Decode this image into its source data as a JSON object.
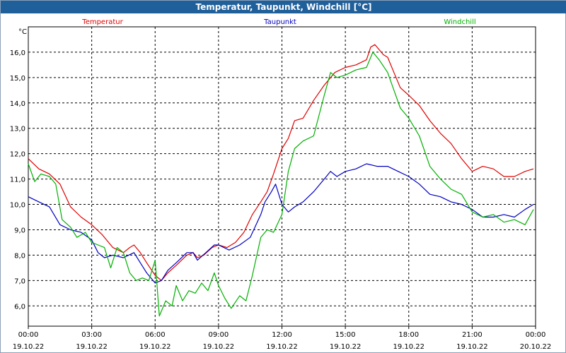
{
  "title": "Temperatur, Taupunkt, Windchill [°C]",
  "chart_data": {
    "type": "line",
    "ylabel": "°C",
    "ylim": [
      5.2,
      17.0
    ],
    "xlim_hours": [
      0,
      24
    ],
    "grid": true,
    "yticks": [
      "6,0",
      "7,0",
      "8,0",
      "9,0",
      "10,0",
      "11,0",
      "12,0",
      "13,0",
      "14,0",
      "15,0",
      "16,0"
    ],
    "yticks_values": [
      6,
      7,
      8,
      9,
      10,
      11,
      12,
      13,
      14,
      15,
      16
    ],
    "xticks": [
      {
        "time": "00:00",
        "date": "19.10.22",
        "h": 0
      },
      {
        "time": "03:00",
        "date": "19.10.22",
        "h": 3
      },
      {
        "time": "06:00",
        "date": "19.10.22",
        "h": 6
      },
      {
        "time": "09:00",
        "date": "19.10.22",
        "h": 9
      },
      {
        "time": "12:00",
        "date": "19.10.22",
        "h": 12
      },
      {
        "time": "15:00",
        "date": "19.10.22",
        "h": 15
      },
      {
        "time": "18:00",
        "date": "19.10.22",
        "h": 18
      },
      {
        "time": "21:00",
        "date": "19.10.22",
        "h": 21
      },
      {
        "time": "00:00",
        "date": "20.10.22",
        "h": 24
      }
    ],
    "series": [
      {
        "name": "Temperatur",
        "color": "#e00000",
        "points": [
          [
            0,
            11.8
          ],
          [
            0.5,
            11.4
          ],
          [
            1,
            11.2
          ],
          [
            1.5,
            10.8
          ],
          [
            2,
            9.9
          ],
          [
            2.5,
            9.5
          ],
          [
            3,
            9.2
          ],
          [
            3.5,
            8.8
          ],
          [
            4,
            8.3
          ],
          [
            4.5,
            8.1
          ],
          [
            4.8,
            8.3
          ],
          [
            5,
            8.4
          ],
          [
            5.3,
            8.1
          ],
          [
            5.6,
            7.7
          ],
          [
            6,
            7.2
          ],
          [
            6.3,
            7.0
          ],
          [
            6.6,
            7.3
          ],
          [
            7,
            7.6
          ],
          [
            7.5,
            8.0
          ],
          [
            7.8,
            8.1
          ],
          [
            8,
            7.9
          ],
          [
            8.3,
            8.0
          ],
          [
            8.7,
            8.3
          ],
          [
            9,
            8.4
          ],
          [
            9.4,
            8.3
          ],
          [
            9.8,
            8.5
          ],
          [
            10.2,
            8.9
          ],
          [
            10.6,
            9.6
          ],
          [
            11,
            10.1
          ],
          [
            11.3,
            10.5
          ],
          [
            11.6,
            11.2
          ],
          [
            12,
            12.2
          ],
          [
            12.3,
            12.6
          ],
          [
            12.6,
            13.3
          ],
          [
            13,
            13.4
          ],
          [
            13.5,
            14.1
          ],
          [
            14,
            14.7
          ],
          [
            14.5,
            15.2
          ],
          [
            15,
            15.4
          ],
          [
            15.5,
            15.5
          ],
          [
            16,
            15.7
          ],
          [
            16.2,
            16.2
          ],
          [
            16.4,
            16.3
          ],
          [
            16.8,
            15.9
          ],
          [
            17,
            15.8
          ],
          [
            17.3,
            15.2
          ],
          [
            17.6,
            14.6
          ],
          [
            18,
            14.3
          ],
          [
            18.5,
            13.9
          ],
          [
            19,
            13.3
          ],
          [
            19.5,
            12.8
          ],
          [
            20,
            12.4
          ],
          [
            20.5,
            11.8
          ],
          [
            21,
            11.3
          ],
          [
            21.5,
            11.5
          ],
          [
            22,
            11.4
          ],
          [
            22.5,
            11.1
          ],
          [
            23,
            11.1
          ],
          [
            23.5,
            11.3
          ],
          [
            23.9,
            11.4
          ]
        ]
      },
      {
        "name": "Taupunkt",
        "color": "#0000c0",
        "points": [
          [
            0,
            10.3
          ],
          [
            0.5,
            10.1
          ],
          [
            1,
            9.9
          ],
          [
            1.5,
            9.2
          ],
          [
            2,
            9.0
          ],
          [
            2.5,
            8.9
          ],
          [
            3,
            8.6
          ],
          [
            3.3,
            8.1
          ],
          [
            3.6,
            7.9
          ],
          [
            4,
            8.0
          ],
          [
            4.5,
            7.9
          ],
          [
            5,
            8.1
          ],
          [
            5.3,
            7.7
          ],
          [
            5.6,
            7.3
          ],
          [
            6,
            6.9
          ],
          [
            6.3,
            7.0
          ],
          [
            6.6,
            7.4
          ],
          [
            7,
            7.7
          ],
          [
            7.5,
            8.1
          ],
          [
            7.8,
            8.1
          ],
          [
            8,
            7.8
          ],
          [
            8.4,
            8.1
          ],
          [
            8.8,
            8.4
          ],
          [
            9,
            8.4
          ],
          [
            9.5,
            8.2
          ],
          [
            10,
            8.4
          ],
          [
            10.5,
            8.7
          ],
          [
            11,
            9.6
          ],
          [
            11.2,
            10.1
          ],
          [
            11.5,
            10.5
          ],
          [
            11.7,
            10.8
          ],
          [
            12,
            10.0
          ],
          [
            12.3,
            9.7
          ],
          [
            12.6,
            9.9
          ],
          [
            13,
            10.1
          ],
          [
            13.5,
            10.5
          ],
          [
            14,
            11.0
          ],
          [
            14.3,
            11.3
          ],
          [
            14.6,
            11.1
          ],
          [
            15,
            11.3
          ],
          [
            15.5,
            11.4
          ],
          [
            16,
            11.6
          ],
          [
            16.5,
            11.5
          ],
          [
            17,
            11.5
          ],
          [
            17.5,
            11.3
          ],
          [
            18,
            11.1
          ],
          [
            18.5,
            10.8
          ],
          [
            19,
            10.4
          ],
          [
            19.5,
            10.3
          ],
          [
            20,
            10.1
          ],
          [
            20.5,
            10.0
          ],
          [
            21,
            9.8
          ],
          [
            21.5,
            9.5
          ],
          [
            22,
            9.5
          ],
          [
            22.5,
            9.6
          ],
          [
            23,
            9.5
          ],
          [
            23.5,
            9.8
          ],
          [
            23.9,
            10.0
          ]
        ]
      },
      {
        "name": "Windchill",
        "color": "#00b000",
        "points": [
          [
            0,
            11.6
          ],
          [
            0.3,
            10.9
          ],
          [
            0.6,
            11.2
          ],
          [
            1,
            11.1
          ],
          [
            1.3,
            10.8
          ],
          [
            1.6,
            9.4
          ],
          [
            2,
            9.1
          ],
          [
            2.3,
            8.7
          ],
          [
            2.7,
            8.9
          ],
          [
            3,
            8.5
          ],
          [
            3.3,
            8.4
          ],
          [
            3.6,
            8.3
          ],
          [
            3.9,
            7.5
          ],
          [
            4.2,
            8.3
          ],
          [
            4.5,
            8.1
          ],
          [
            4.8,
            7.3
          ],
          [
            5.1,
            7.0
          ],
          [
            5.4,
            7.1
          ],
          [
            5.7,
            7.0
          ],
          [
            6,
            7.8
          ],
          [
            6.2,
            5.6
          ],
          [
            6.5,
            6.2
          ],
          [
            6.8,
            6.0
          ],
          [
            7,
            6.8
          ],
          [
            7.3,
            6.2
          ],
          [
            7.6,
            6.6
          ],
          [
            7.9,
            6.5
          ],
          [
            8.2,
            6.9
          ],
          [
            8.5,
            6.6
          ],
          [
            8.8,
            7.3
          ],
          [
            9,
            6.8
          ],
          [
            9.3,
            6.3
          ],
          [
            9.6,
            5.9
          ],
          [
            10,
            6.4
          ],
          [
            10.3,
            6.2
          ],
          [
            10.6,
            7.2
          ],
          [
            11,
            8.7
          ],
          [
            11.3,
            9.0
          ],
          [
            11.6,
            8.9
          ],
          [
            12,
            9.6
          ],
          [
            12.3,
            11.3
          ],
          [
            12.6,
            12.2
          ],
          [
            13,
            12.5
          ],
          [
            13.5,
            12.7
          ],
          [
            14,
            14.3
          ],
          [
            14.3,
            15.2
          ],
          [
            14.6,
            15.0
          ],
          [
            15,
            15.1
          ],
          [
            15.5,
            15.3
          ],
          [
            16,
            15.4
          ],
          [
            16.3,
            16.0
          ],
          [
            16.6,
            15.7
          ],
          [
            17,
            15.2
          ],
          [
            17.3,
            14.5
          ],
          [
            17.6,
            13.8
          ],
          [
            18,
            13.4
          ],
          [
            18.5,
            12.7
          ],
          [
            19,
            11.5
          ],
          [
            19.5,
            11.0
          ],
          [
            20,
            10.6
          ],
          [
            20.5,
            10.4
          ],
          [
            21,
            9.7
          ],
          [
            21.5,
            9.5
          ],
          [
            22,
            9.6
          ],
          [
            22.5,
            9.3
          ],
          [
            23,
            9.4
          ],
          [
            23.5,
            9.2
          ],
          [
            23.9,
            9.8
          ]
        ]
      }
    ]
  }
}
